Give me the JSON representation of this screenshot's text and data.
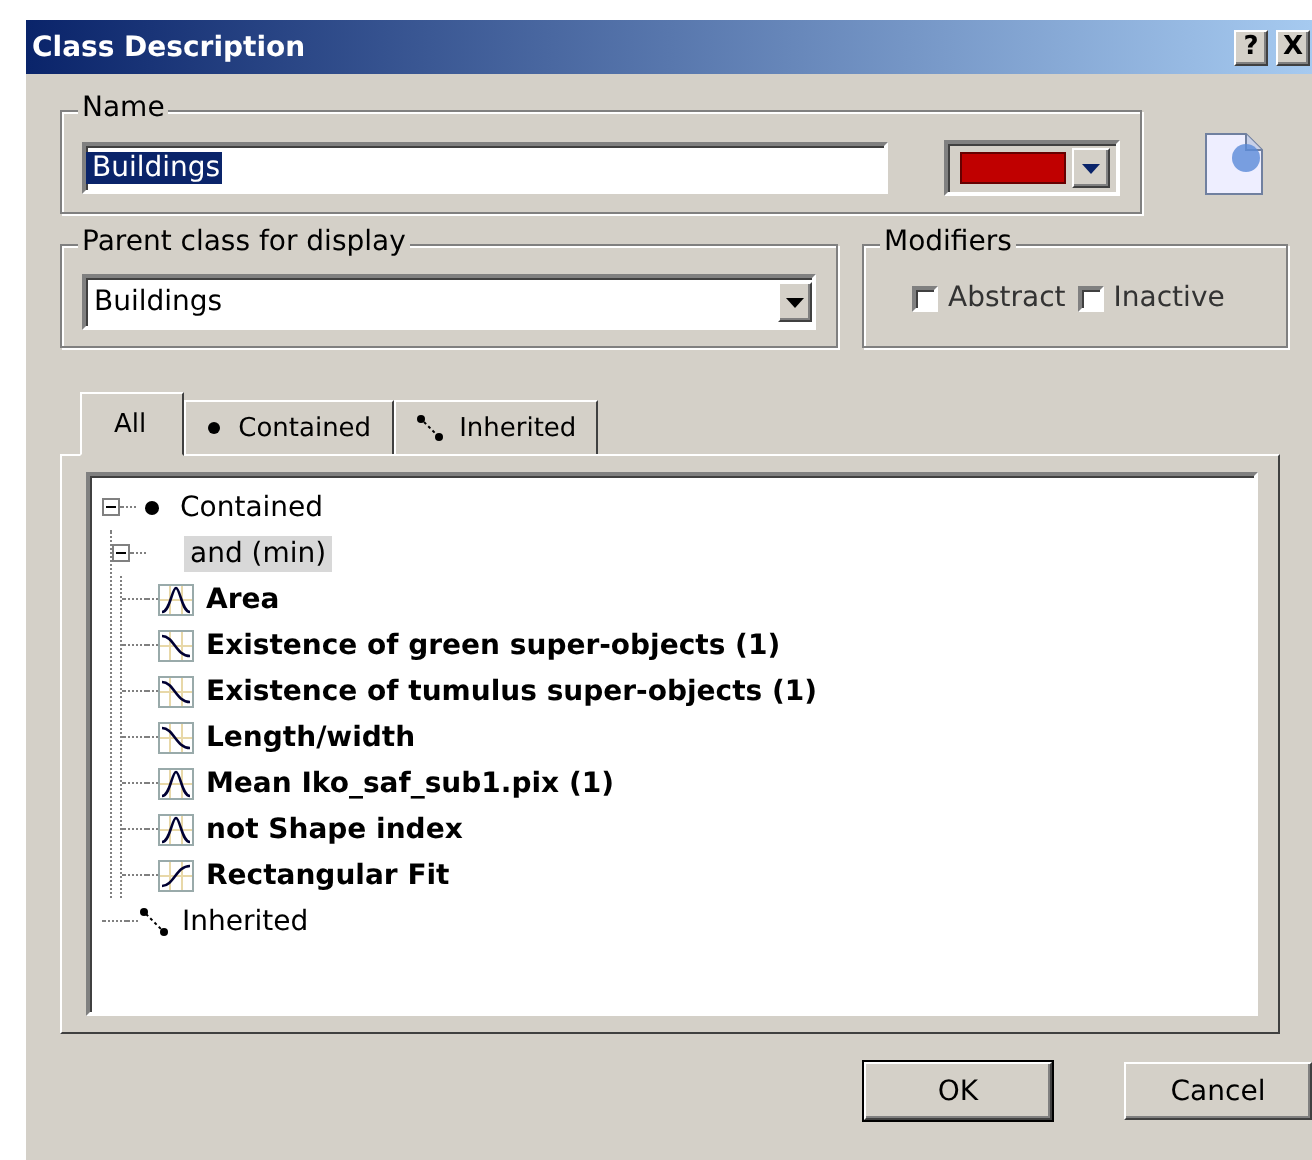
{
  "window": {
    "title": "Class Description",
    "help_button": "?",
    "close_button": "X"
  },
  "name_group": {
    "label": "Name",
    "value": "Buildings",
    "text_selected": true,
    "color": "#c00000"
  },
  "parent_group": {
    "label": "Parent class for display",
    "value": "Buildings"
  },
  "modifiers": {
    "label": "Modifiers",
    "options": [
      {
        "label": "Abstract",
        "checked": false
      },
      {
        "label": "Inactive",
        "checked": false
      }
    ]
  },
  "tabs": [
    {
      "label": "All",
      "kind": "all",
      "selected": true
    },
    {
      "label": "Contained",
      "kind": "contained",
      "selected": false
    },
    {
      "label": "Inherited",
      "kind": "inherited",
      "selected": false
    }
  ],
  "tree": [
    {
      "label": "Contained",
      "kind": "group",
      "expanded": true,
      "selected": false,
      "children": [
        {
          "label": "and (min)",
          "kind": "operator",
          "expanded": true,
          "selected": true,
          "children": [
            {
              "label": "Area",
              "kind": "peak",
              "selected": false
            },
            {
              "label": "Existence of green super-objects  (1)",
              "kind": "falling",
              "selected": false
            },
            {
              "label": "Existence of tumulus super-objects  (1)",
              "kind": "falling",
              "selected": false
            },
            {
              "label": "Length/width",
              "kind": "falling",
              "selected": false
            },
            {
              "label": "Mean Iko_saf_sub1.pix (1)",
              "kind": "peak",
              "selected": false
            },
            {
              "label": "not Shape index",
              "kind": "peak",
              "selected": false
            },
            {
              "label": "Rectangular Fit",
              "kind": "rising",
              "selected": false
            }
          ]
        }
      ]
    },
    {
      "label": "Inherited",
      "kind": "inherited",
      "selected": false
    }
  ],
  "buttons": [
    {
      "label": "OK",
      "default": true
    },
    {
      "label": "Cancel",
      "default": false
    }
  ]
}
